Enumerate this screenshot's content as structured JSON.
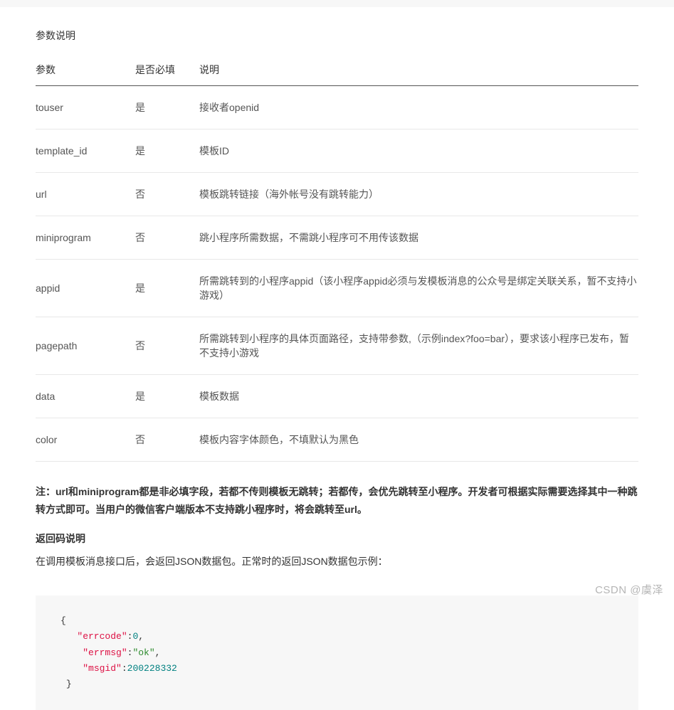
{
  "sectionTitle": "参数说明",
  "table": {
    "headers": {
      "param": "参数",
      "required": "是否必填",
      "desc": "说明"
    },
    "rows": [
      {
        "param": "touser",
        "required": "是",
        "desc": "接收者openid"
      },
      {
        "param": "template_id",
        "required": "是",
        "desc": "模板ID"
      },
      {
        "param": "url",
        "required": "否",
        "desc": "模板跳转链接（海外帐号没有跳转能力）"
      },
      {
        "param": "miniprogram",
        "required": "否",
        "desc": "跳小程序所需数据，不需跳小程序可不用传该数据"
      },
      {
        "param": "appid",
        "required": "是",
        "desc": "所需跳转到的小程序appid（该小程序appid必须与发模板消息的公众号是绑定关联关系，暂不支持小游戏）"
      },
      {
        "param": "pagepath",
        "required": "否",
        "desc": "所需跳转到小程序的具体页面路径，支持带参数,（示例index?foo=bar），要求该小程序已发布，暂不支持小游戏"
      },
      {
        "param": "data",
        "required": "是",
        "desc": "模板数据"
      },
      {
        "param": "color",
        "required": "否",
        "desc": "模板内容字体颜色，不填默认为黑色"
      }
    ]
  },
  "note": "注：url和miniprogram都是非必填字段，若都不传则模板无跳转；若都传，会优先跳转至小程序。开发者可根据实际需要选择其中一种跳转方式即可。当用户的微信客户端版本不支持跳小程序时，将会跳转至url。",
  "subTitle": "返回码说明",
  "descText": "在调用模板消息接口后，会返回JSON数据包。正常时的返回JSON数据包示例：",
  "code": {
    "k1": "\"errcode\"",
    "v1": "0",
    "k2": "\"errmsg\"",
    "v2": "\"ok\"",
    "k3": "\"msgid\"",
    "v3": "200228332"
  },
  "watermark": "CSDN @虞泽"
}
